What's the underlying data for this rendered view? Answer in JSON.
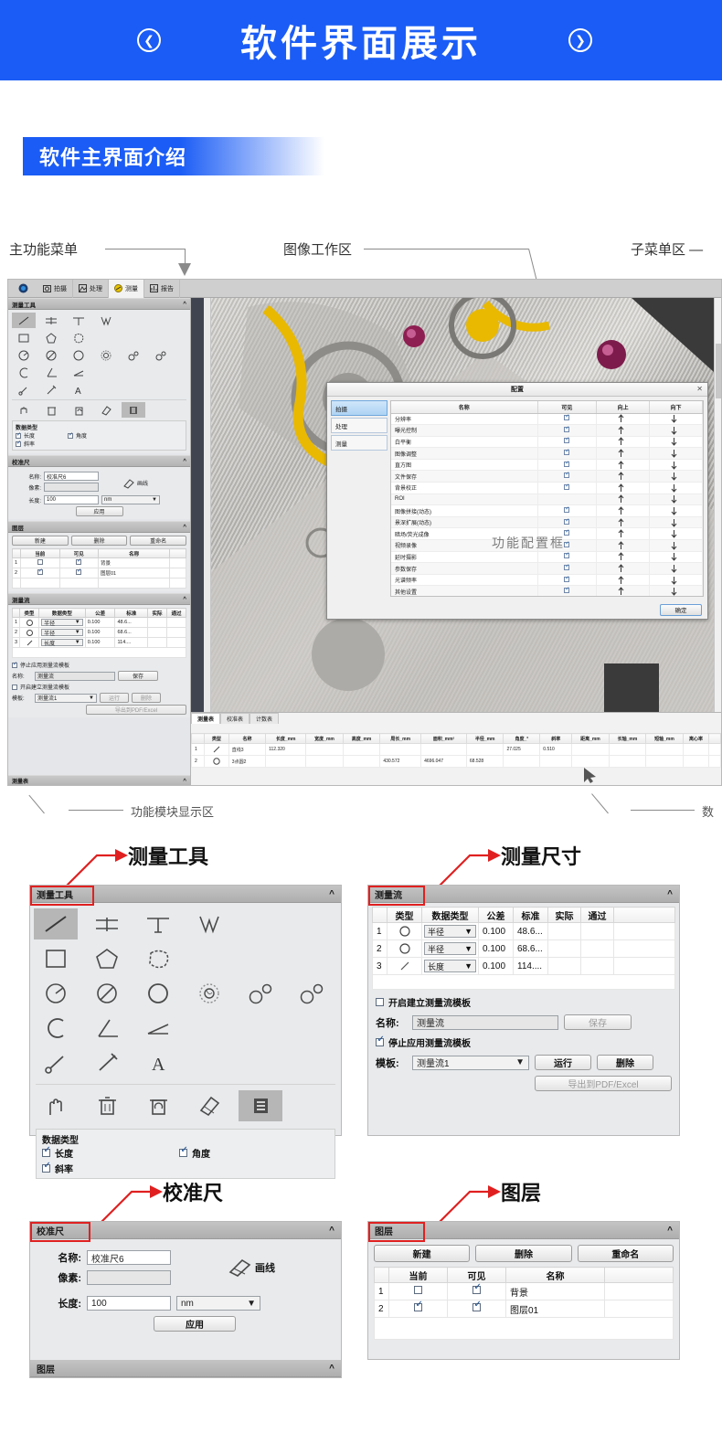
{
  "banner": {
    "title": "软件界面展示",
    "prev_icon": "chevron-left-icon",
    "next_icon": "chevron-right-icon"
  },
  "section": {
    "title": "软件主界面介绍"
  },
  "callouts": {
    "main_menu": "主功能菜单",
    "image_workspace": "图像工作区",
    "submenu_area": "子菜单区",
    "function_module_area": "功能模块显示区",
    "data_area": "数"
  },
  "app": {
    "ribbon_tabs": [
      {
        "label": "拍摄",
        "icon": "camera-icon",
        "active": false
      },
      {
        "label": "处理",
        "icon": "process-icon",
        "active": false
      },
      {
        "label": "测量",
        "icon": "measure-icon",
        "active": true
      },
      {
        "label": "报告",
        "icon": "report-icon",
        "active": false
      }
    ],
    "panels": {
      "measure_tools": {
        "title": "测量工具",
        "collapse_icon": "chevron-up-icon",
        "data_type_group": "数据类型",
        "checks": [
          {
            "label": "长度",
            "checked": true
          },
          {
            "label": "角度",
            "checked": true
          },
          {
            "label": "斜率",
            "checked": true
          }
        ]
      },
      "calibration": {
        "title": "校准尺",
        "name_label": "名称:",
        "name_value": "校准尺6",
        "pixel_label": "像素:",
        "pixel_value": "",
        "length_label": "长度:",
        "length_value": "100",
        "unit_value": "nm",
        "draw_line": "画线",
        "apply": "应用"
      },
      "layers": {
        "title": "图层",
        "new": "新建",
        "delete": "删除",
        "rename": "重命名",
        "columns": [
          "当前",
          "可见",
          "名称"
        ],
        "rows": [
          {
            "index": "1",
            "current": false,
            "visible": true,
            "name": "背景"
          },
          {
            "index": "2",
            "current": true,
            "visible": true,
            "name": "图层01"
          }
        ]
      },
      "flow": {
        "title": "测量流",
        "columns": [
          "类型",
          "数据类型",
          "公差",
          "标准",
          "实际",
          "通过"
        ],
        "rows": [
          {
            "index": "1",
            "type": "circle",
            "datatype": "半径",
            "tol": "0.100",
            "std": "48.6...",
            "actual": "",
            "pass": ""
          },
          {
            "index": "2",
            "type": "circle",
            "datatype": "半径",
            "tol": "0.100",
            "std": "68.6...",
            "actual": "",
            "pass": ""
          },
          {
            "index": "3",
            "type": "line",
            "datatype": "长度",
            "tol": "0.100",
            "std": "114....",
            "actual": "",
            "pass": ""
          }
        ],
        "create_template_check": {
          "label": "开启建立测量流模板",
          "checked": false
        },
        "stop_template_check": {
          "label": "停止应用测量流模板",
          "checked": true
        },
        "name_label": "名称:",
        "name_value": "测量流",
        "save": "保存",
        "template_label": "模板:",
        "template_value": "测量流1",
        "run": "运行",
        "delete": "删除",
        "export": "导出到PDF/Excel"
      }
    },
    "dialog": {
      "title": "配置",
      "close_icon": "close-icon",
      "watermark": "功能配置框",
      "tabs": [
        {
          "label": "拍摄",
          "active": true
        },
        {
          "label": "处理",
          "active": false
        },
        {
          "label": "测量",
          "active": false
        }
      ],
      "columns": [
        "名称",
        "可见",
        "向上",
        "向下"
      ],
      "rows": [
        {
          "name": "分辨率",
          "visible": true
        },
        {
          "name": "曝光控制",
          "visible": true
        },
        {
          "name": "白平衡",
          "visible": true
        },
        {
          "name": "图像调整",
          "visible": true
        },
        {
          "name": "直方图",
          "visible": true
        },
        {
          "name": "文件保存",
          "visible": true
        },
        {
          "name": "背景校正",
          "visible": true
        },
        {
          "name": "ROI",
          "visible": false
        },
        {
          "name": "图像拼接(动态)",
          "visible": true
        },
        {
          "name": "景深扩展(动态)",
          "visible": true
        },
        {
          "name": "暗场/荧光成像",
          "visible": true
        },
        {
          "name": "视频录像",
          "visible": true
        },
        {
          "name": "延时摄影",
          "visible": true
        },
        {
          "name": "参数保存",
          "visible": true
        },
        {
          "name": "光谱频率",
          "visible": true
        },
        {
          "name": "其他设置",
          "visible": true
        }
      ],
      "ok": "确定",
      "up_arrow": "arrow-up-icon",
      "down_arrow": "arrow-down-icon"
    },
    "results": {
      "tabs": [
        {
          "label": "测量表",
          "active": true
        },
        {
          "label": "校准表",
          "active": false
        },
        {
          "label": "计数表",
          "active": false
        }
      ],
      "columns": [
        "类型",
        "名称",
        "长度_mm",
        "宽度_mm",
        "高度_mm",
        "周长_mm",
        "面积_mm²",
        "半径_mm",
        "角度_°",
        "斜率",
        "距离_mm",
        "长轴_mm",
        "短轴_mm",
        "离心率"
      ],
      "rows": [
        {
          "index": "1",
          "type": "line",
          "name": "直线3",
          "length": "112.320",
          "width": "",
          "height": "",
          "perimeter": "",
          "area": "",
          "radius": "",
          "angle": "27.025",
          "slope": "0.510",
          "distance": "",
          "major": "",
          "minor": "",
          "ecc": ""
        },
        {
          "index": "2",
          "type": "circle",
          "name": "3点圆2",
          "length": "",
          "width": "",
          "height": "",
          "perimeter": "430.572",
          "area": "4696.047",
          "radius": "68.528",
          "angle": "",
          "slope": "",
          "distance": "",
          "major": "",
          "minor": "",
          "ecc": ""
        }
      ]
    }
  },
  "detail_labels": {
    "measure_tools": "测量工具",
    "measure_size": "测量尺寸",
    "calibration": "校准尺",
    "layers": "图层"
  },
  "colors": {
    "brand_blue": "#1a5cf5",
    "highlight_red": "#e02020",
    "panel_gray": "#e8eaec",
    "header_gray": "#b4b4b4"
  }
}
